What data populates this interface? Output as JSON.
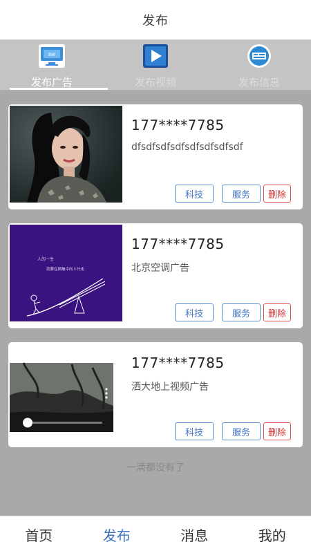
{
  "header": {
    "title": "发布"
  },
  "tabs": [
    {
      "label": "发布广告",
      "icon": "monitor-icon",
      "active": true
    },
    {
      "label": "发布视频",
      "icon": "video-play-icon",
      "active": false
    },
    {
      "label": "发布信息",
      "icon": "info-card-icon",
      "active": false
    }
  ],
  "posts": [
    {
      "phone": "177****7785",
      "description": "dfsdfsdfsdfsdfsdfsdfsdf",
      "tag1": "科技",
      "tag2": "服务",
      "delete_label": "删除",
      "thumb": "portrait-photo"
    },
    {
      "phone": "177****7785",
      "description": "北京空调广告",
      "tag1": "科技",
      "tag2": "服务",
      "delete_label": "删除",
      "thumb": "purple-illustration",
      "thumb_text": [
        "人的一生",
        "就要在颠簸中向上行走"
      ]
    },
    {
      "phone": "177****7785",
      "description": "洒大地上视频广告",
      "tag1": "科技",
      "tag2": "服务",
      "delete_label": "删除",
      "thumb": "video-player"
    }
  ],
  "end_text": "一滴都没有了",
  "bottom_nav": [
    {
      "label": "首页",
      "active": false
    },
    {
      "label": "发布",
      "active": true
    },
    {
      "label": "消息",
      "active": false
    },
    {
      "label": "我的",
      "active": false
    }
  ],
  "colors": {
    "accent": "#3e73c0",
    "danger": "#d93232",
    "tab_bar": "#c4c4c4",
    "background": "#a9a9a9"
  }
}
